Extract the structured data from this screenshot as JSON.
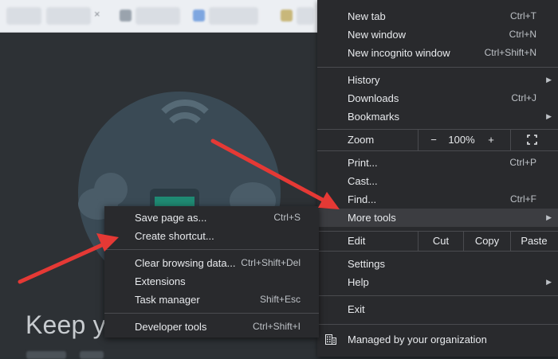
{
  "background": {
    "heading_fragment": "Keep yo"
  },
  "menu": {
    "new_tab": {
      "label": "New tab",
      "shortcut": "Ctrl+T"
    },
    "new_window": {
      "label": "New window",
      "shortcut": "Ctrl+N"
    },
    "new_incognito": {
      "label": "New incognito window",
      "shortcut": "Ctrl+Shift+N"
    },
    "history": {
      "label": "History"
    },
    "downloads": {
      "label": "Downloads",
      "shortcut": "Ctrl+J"
    },
    "bookmarks": {
      "label": "Bookmarks"
    },
    "zoom": {
      "label": "Zoom",
      "minus": "−",
      "level": "100%",
      "plus": "+"
    },
    "print": {
      "label": "Print...",
      "shortcut": "Ctrl+P"
    },
    "cast": {
      "label": "Cast..."
    },
    "find": {
      "label": "Find...",
      "shortcut": "Ctrl+F"
    },
    "more_tools": {
      "label": "More tools"
    },
    "edit": {
      "label": "Edit",
      "cut": "Cut",
      "copy": "Copy",
      "paste": "Paste"
    },
    "settings": {
      "label": "Settings"
    },
    "help": {
      "label": "Help"
    },
    "exit": {
      "label": "Exit"
    },
    "managed": {
      "label": "Managed by your organization"
    }
  },
  "submenu": {
    "save_page": {
      "label": "Save page as...",
      "shortcut": "Ctrl+S"
    },
    "create_shortcut": {
      "label": "Create shortcut..."
    },
    "clear_browsing": {
      "label": "Clear browsing data...",
      "shortcut": "Ctrl+Shift+Del"
    },
    "extensions": {
      "label": "Extensions"
    },
    "task_manager": {
      "label": "Task manager",
      "shortcut": "Shift+Esc"
    },
    "developer_tools": {
      "label": "Developer tools",
      "shortcut": "Ctrl+Shift+I"
    }
  },
  "colors": {
    "menu_bg": "#292a2d",
    "highlight": "#3c3d41",
    "annotation_arrow": "#e53935"
  }
}
